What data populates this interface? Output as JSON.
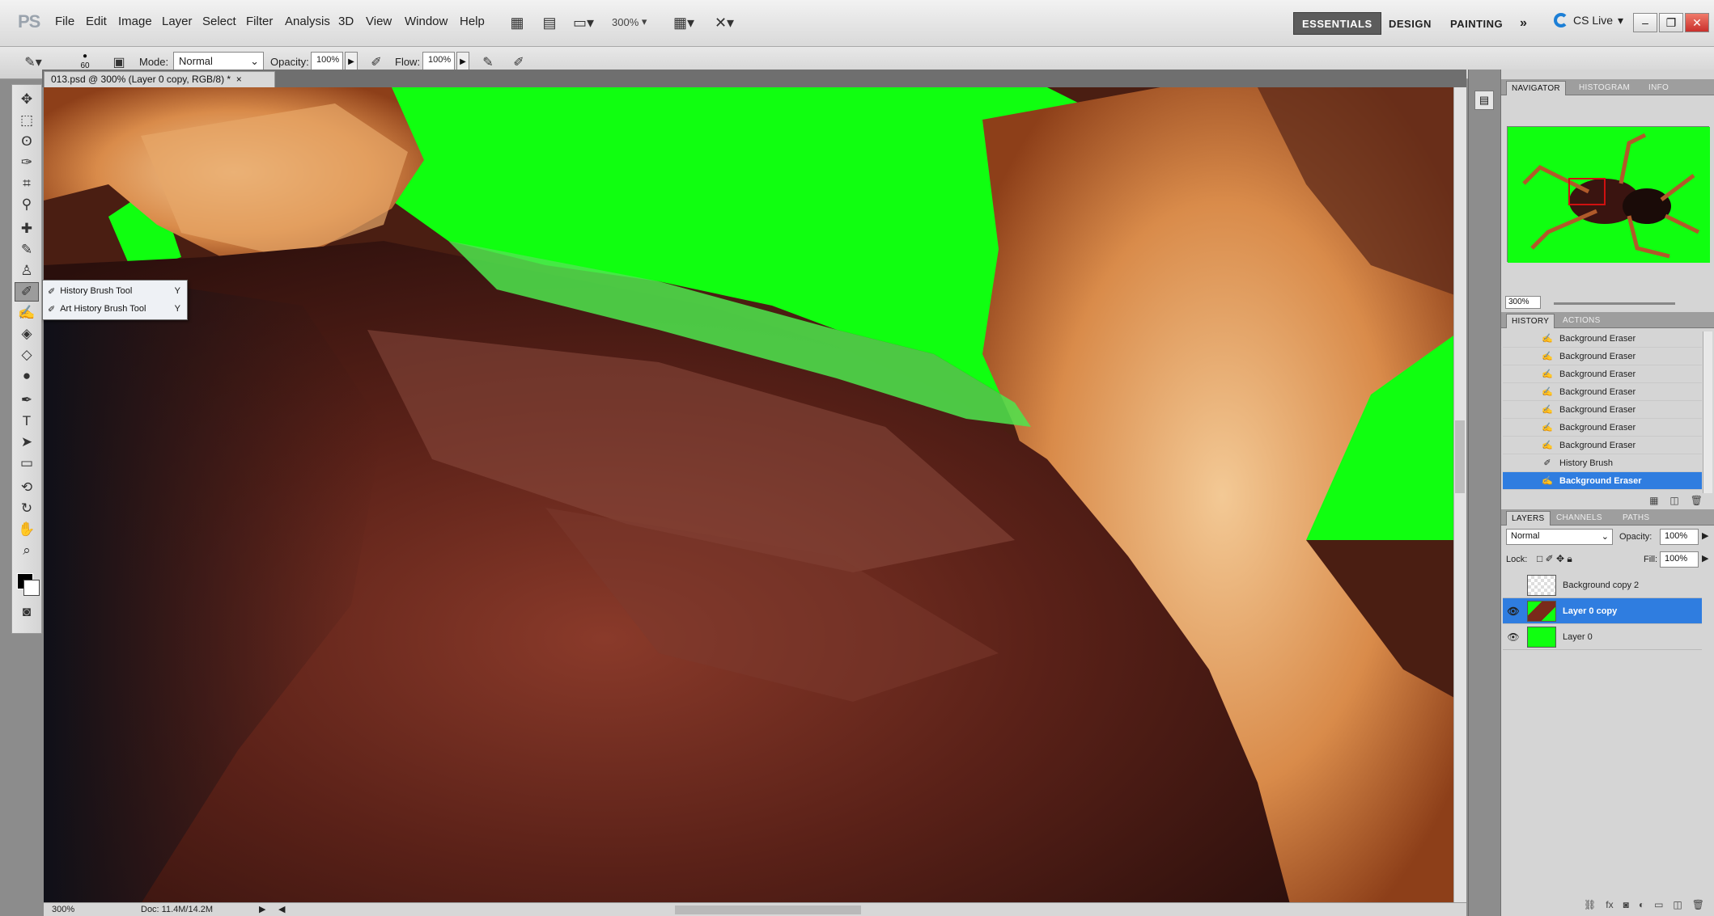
{
  "app": {
    "logo": "PS"
  },
  "menu": [
    "File",
    "Edit",
    "Image",
    "Layer",
    "Select",
    "Filter",
    "Analysis",
    "3D",
    "View",
    "Window",
    "Help"
  ],
  "menubar": {
    "zoom": "300%"
  },
  "workspaces": {
    "essentials": "ESSENTIALS",
    "design": "DESIGN",
    "painting": "PAINTING",
    "more": "»"
  },
  "cslive": "CS Live",
  "options": {
    "brush_size": "60",
    "mode_label": "Mode:",
    "mode_value": "Normal",
    "opacity_label": "Opacity:",
    "opacity_value": "100%",
    "flow_label": "Flow:",
    "flow_value": "100%"
  },
  "document": {
    "tab_title": "013.psd @ 300% (Layer 0 copy, RGB/8) *",
    "close": "×"
  },
  "flyout": [
    {
      "label": "History Brush Tool",
      "key": "Y"
    },
    {
      "label": "Art History Brush Tool",
      "key": "Y"
    }
  ],
  "status": {
    "zoom": "300%",
    "doc": "Doc: 11.4M/14.2M"
  },
  "navigator": {
    "tabs": [
      "NAVIGATOR",
      "HISTOGRAM",
      "INFO"
    ],
    "zoom": "300%"
  },
  "history": {
    "tabs": [
      "HISTORY",
      "ACTIONS"
    ],
    "items": [
      {
        "label": "Background Eraser",
        "selected": false
      },
      {
        "label": "Background Eraser",
        "selected": false
      },
      {
        "label": "Background Eraser",
        "selected": false
      },
      {
        "label": "Background Eraser",
        "selected": false
      },
      {
        "label": "Background Eraser",
        "selected": false
      },
      {
        "label": "Background Eraser",
        "selected": false
      },
      {
        "label": "Background Eraser",
        "selected": false
      },
      {
        "label": "History Brush",
        "selected": false
      },
      {
        "label": "Background Eraser",
        "selected": true
      }
    ]
  },
  "layers": {
    "tabs": [
      "LAYERS",
      "CHANNELS",
      "PATHS"
    ],
    "blend_mode": "Normal",
    "opacity_label": "Opacity:",
    "opacity_value": "100%",
    "lock_label": "Lock:",
    "fill_label": "Fill:",
    "fill_value": "100%",
    "items": [
      {
        "name": "Background copy 2",
        "selected": false,
        "visible": false
      },
      {
        "name": "Layer 0 copy",
        "selected": true,
        "visible": true
      },
      {
        "name": "Layer 0",
        "selected": false,
        "visible": true
      }
    ]
  },
  "colors": {
    "accent": "#2f7de0",
    "chroma_green": "#10ff10"
  }
}
